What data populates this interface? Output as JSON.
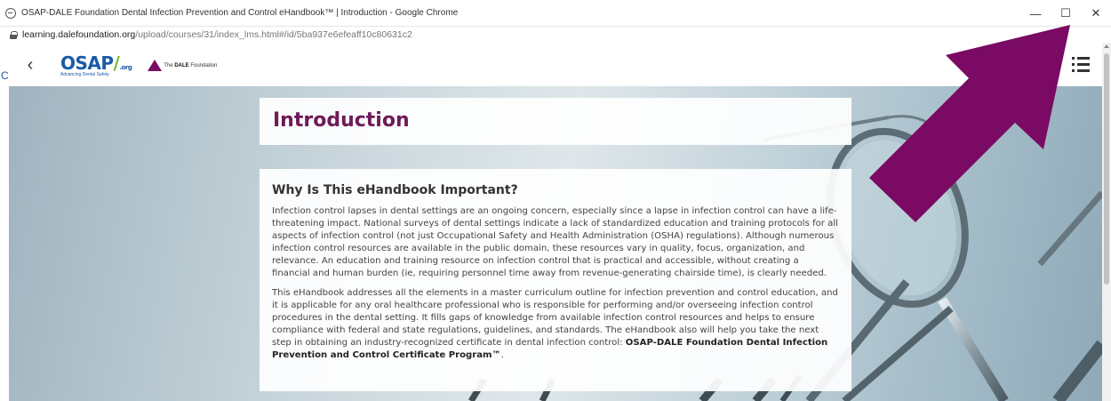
{
  "window": {
    "title": "OSAP-DALE Foundation Dental Infection Prevention and Control eHandbook™ | Introduction - Google Chrome",
    "minimize_glyph": "—",
    "maximize_glyph": "☐",
    "close_glyph": "✕"
  },
  "address_bar": {
    "domain": "learning.dalefoundation.org",
    "path": "/upload/courses/31/index_lms.html#/id/5ba937e6efeaff10c80631c2"
  },
  "header": {
    "back_glyph": "‹",
    "osap_logo_text": "OSAP",
    "osap_logo_suffix": ".org",
    "osap_tagline": "Advancing Dental Safety",
    "dale_logo_prefix": "The",
    "dale_logo_bold": "DALE",
    "dale_logo_suffix": "Foundation",
    "left_fragment": "C"
  },
  "content": {
    "page_title": "Introduction",
    "section_heading": "Why Is This eHandbook Important?",
    "paragraph1": "Infection control lapses in dental settings are an ongoing concern, especially since a lapse in infection control can have a life-threatening impact. National surveys of dental settings indicate a lack of standardized education and training protocols for all aspects of infection control (not just Occupational Safety and Health Administration (OSHA) regulations). Although numerous infection control resources are available in the public domain, these resources vary in quality, focus, organization, and relevance. An education and training resource on infection control that is practical and accessible, without creating a financial and human burden (ie, requiring personnel time away from revenue-generating chairside time), is clearly needed.",
    "paragraph2_text": "This eHandbook addresses all the elements in a master curriculum outline for infection prevention and control education, and it is applicable for any oral healthcare professional who is responsible for performing and/or overseeing infection control procedures in the dental setting. It fills gaps of knowledge from available infection control resources and helps to ensure compliance with federal and state regulations, guidelines, and standards. The eHandbook also will help you take the next step in obtaining an industry-recognized certificate in dental infection control: ",
    "paragraph2_bold": "OSAP-DALE Foundation Dental Infection Prevention and Control Certificate Program™",
    "paragraph2_end": "."
  },
  "colors": {
    "title_purple": "#6d1b59",
    "arrow_purple": "#7a0a63",
    "osap_blue": "#1a5aa8",
    "osap_green": "#79b829"
  },
  "icons": {
    "menu": "list-menu-icon",
    "back": "chevron-left-icon",
    "lock": "lock-icon",
    "favicon": "chrome-page-icon"
  }
}
